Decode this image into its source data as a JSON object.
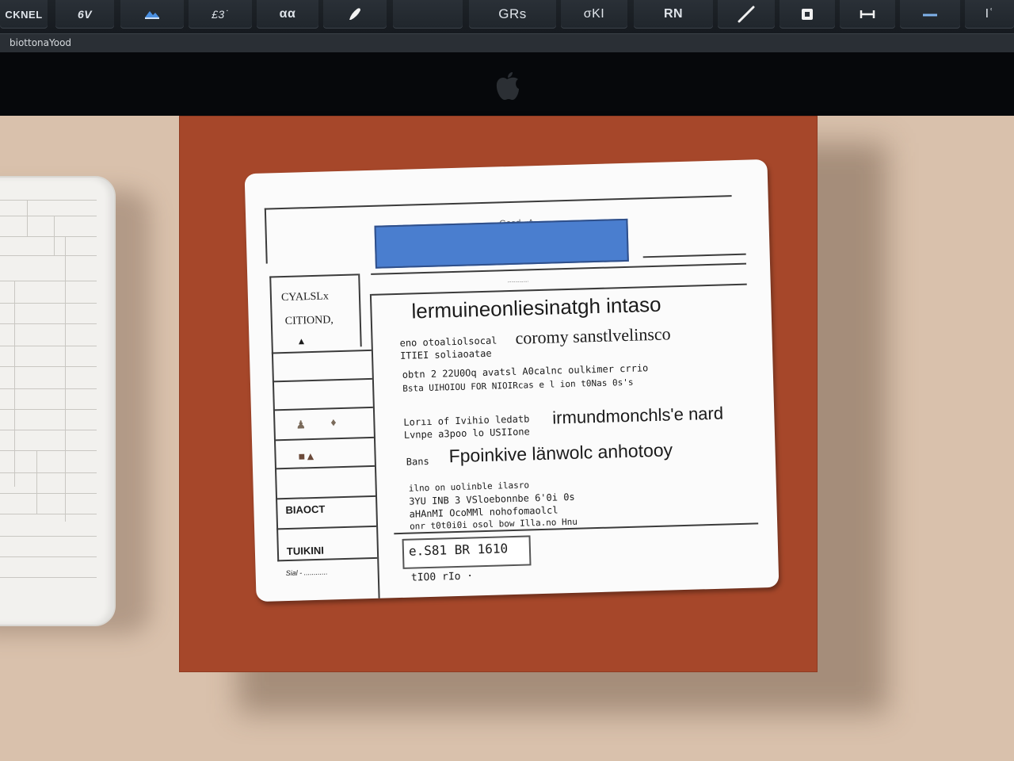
{
  "toolbar": {
    "buttons": [
      {
        "label": "CKNEL",
        "icon": ""
      },
      {
        "label": "6V",
        "icon": ""
      },
      {
        "label": "",
        "icon": "image-icon"
      },
      {
        "label": "£3˙",
        "icon": ""
      },
      {
        "label": "αα",
        "icon": ""
      },
      {
        "label": "",
        "icon": "brush-icon"
      },
      {
        "label": "",
        "icon": ""
      },
      {
        "label": "GRs",
        "icon": ""
      },
      {
        "label": "σKI",
        "icon": ""
      },
      {
        "label": "RN",
        "icon": ""
      },
      {
        "label": "",
        "icon": "pen-icon"
      },
      {
        "label": "",
        "icon": "square-icon"
      },
      {
        "label": "",
        "icon": "dimension-icon"
      },
      {
        "label": "",
        "icon": "minus-icon"
      },
      {
        "label": "Iʿ",
        "icon": "cursor-icon"
      }
    ]
  },
  "statusbar": {
    "text": "biottonaYood"
  },
  "document": {
    "header_small": "Gaad «A",
    "left_panel": {
      "title_line1": "CYALSLx",
      "title_line2": "CITIOND,",
      "label_bottom1": "BIAOCT",
      "label_bottom2": "TUIKINI",
      "footnote": "Sial - ............"
    },
    "tab_label": "................",
    "heading": "lermuineonliesinatgh intaso",
    "line1_small": "eno otoaliolsocal",
    "line1_large": "coromy sanstlvelinsco",
    "line2_small": "ITIEI soliaoatae",
    "line3": "obtn 2 22U0Oq avatsl A0calnc oulkimer crrio",
    "line4": "Bsta UIHOIOU FOR NIOIRcas e l ion t0Nas 0s's",
    "line5_small": "Lorıı of Ivihio ledatb",
    "line6_small": "Lvnpe a3poo lo USIIone",
    "line5_large": "irmundmonchls'e nard",
    "line7_small": "Bans",
    "line7_large": "Fpoinkive länwolc anhotooy",
    "line8": "ilno on uolinble ilasro",
    "line9": "3YU INB 3 VSloebonnbe 6'0i 0s",
    "line10": "aHAnMI OcoMMl nohofomaolcl",
    "line11": "onr t0t0i0i osol bow Illa.no Hnu",
    "code_box": "e.S81 BR 1610",
    "code_below": "tIO0 rIo ·"
  },
  "colors": {
    "folder": "#a6472a",
    "accent_blue": "#4a7ecf",
    "desk": "#d9c1ac",
    "toolbar": "#1e2328"
  }
}
